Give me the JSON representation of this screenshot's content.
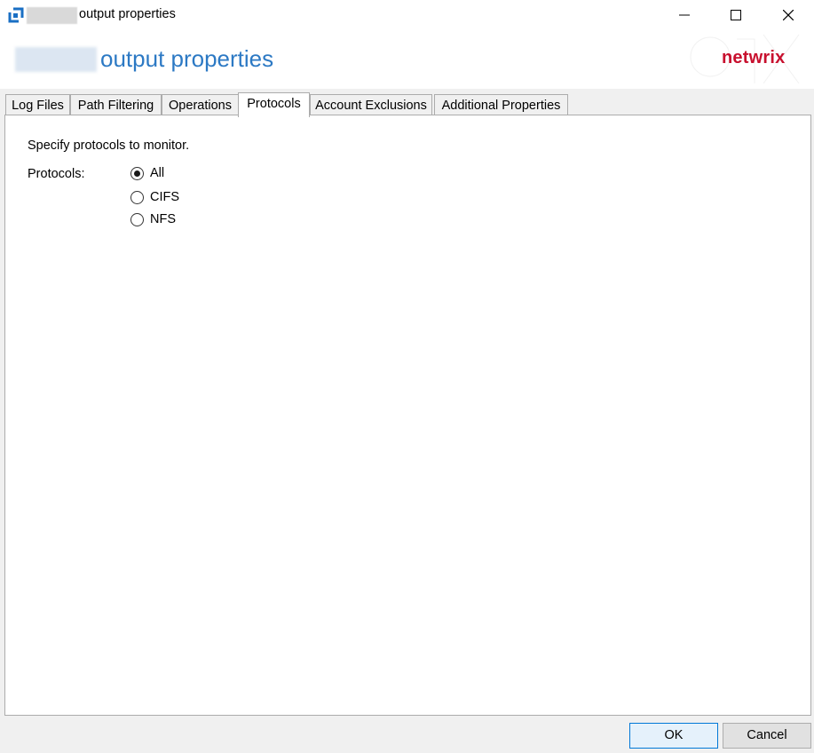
{
  "window": {
    "title": "output properties",
    "icon": "netwrix-app-icon",
    "controls": [
      "minimize-icon",
      "maximize-icon",
      "close-icon"
    ]
  },
  "header": {
    "title": "output properties",
    "brand": "netwrix",
    "brand_color": "#c8102e",
    "title_color": "#2c79c4"
  },
  "tabs": [
    {
      "label": "Log Files"
    },
    {
      "label": "Path Filtering"
    },
    {
      "label": "Operations"
    },
    {
      "label": "Protocols",
      "active": true
    },
    {
      "label": "Account Exclusions"
    },
    {
      "label": "Additional Properties"
    }
  ],
  "protocols": {
    "instruction": "Specify protocols to monitor.",
    "label": "Protocols:",
    "selected": "All",
    "options": [
      {
        "label": "All"
      },
      {
        "label": "CIFS"
      },
      {
        "label": "NFS"
      }
    ]
  },
  "buttons": {
    "ok": "OK",
    "cancel": "Cancel"
  }
}
